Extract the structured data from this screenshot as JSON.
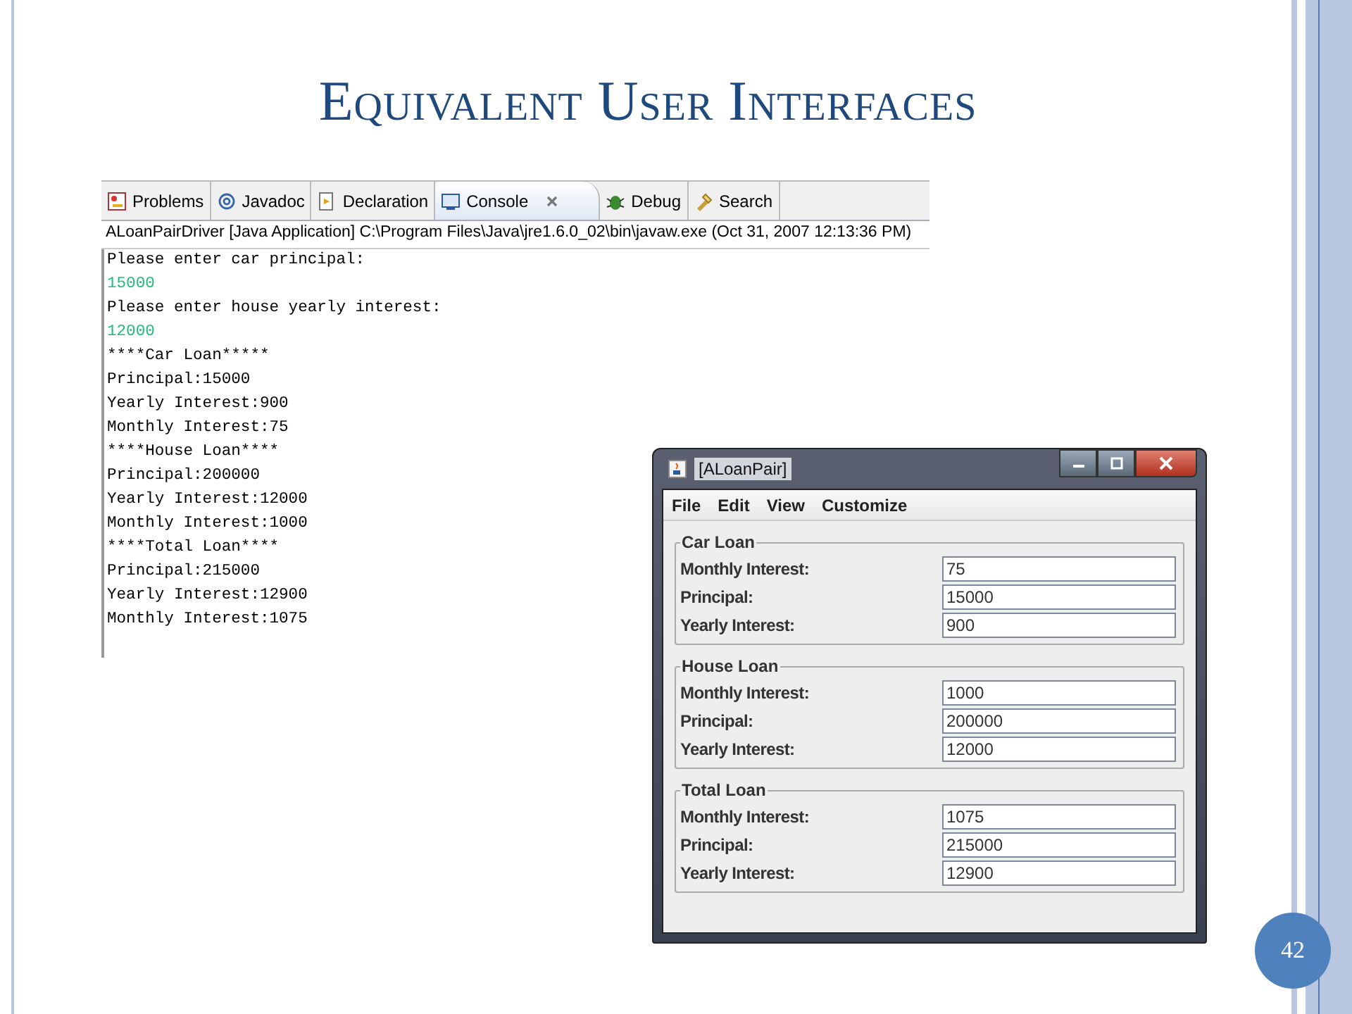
{
  "slide": {
    "title": "Equivalent User Interfaces",
    "page_number": "42"
  },
  "console": {
    "tabs": [
      {
        "label": "Problems",
        "selected": false
      },
      {
        "label": "Javadoc",
        "selected": false
      },
      {
        "label": "Declaration",
        "selected": false
      },
      {
        "label": "Console",
        "selected": true
      },
      {
        "label": "Debug",
        "selected": false
      },
      {
        "label": "Search",
        "selected": false
      }
    ],
    "header": "ALoanPairDriver [Java Application] C:\\Program Files\\Java\\jre1.6.0_02\\bin\\javaw.exe (Oct 31, 2007 12:13:36 PM)",
    "lines": [
      {
        "text": "Please enter car principal:",
        "kind": "output"
      },
      {
        "text": "15000",
        "kind": "input"
      },
      {
        "text": "Please enter house yearly interest:",
        "kind": "output"
      },
      {
        "text": "12000",
        "kind": "input"
      },
      {
        "text": "****Car Loan*****",
        "kind": "output"
      },
      {
        "text": "Principal:15000",
        "kind": "output"
      },
      {
        "text": "Yearly Interest:900",
        "kind": "output"
      },
      {
        "text": "Monthly Interest:75",
        "kind": "output"
      },
      {
        "text": "****House Loan****",
        "kind": "output"
      },
      {
        "text": "Principal:200000",
        "kind": "output"
      },
      {
        "text": "Yearly Interest:12000",
        "kind": "output"
      },
      {
        "text": "Monthly Interest:1000",
        "kind": "output"
      },
      {
        "text": "****Total Loan****",
        "kind": "output"
      },
      {
        "text": "Principal:215000",
        "kind": "output"
      },
      {
        "text": "Yearly Interest:12900",
        "kind": "output"
      },
      {
        "text": "Monthly Interest:1075",
        "kind": "output"
      }
    ]
  },
  "window": {
    "title": "[ALoanPair]",
    "menu": [
      "File",
      "Edit",
      "View",
      "Customize"
    ],
    "groups": [
      {
        "title": "Car Loan",
        "fields": [
          {
            "label": "Monthly Interest:",
            "value": "75"
          },
          {
            "label": "Principal:",
            "value": "15000"
          },
          {
            "label": "Yearly Interest:",
            "value": "900"
          }
        ]
      },
      {
        "title": "House Loan",
        "fields": [
          {
            "label": "Monthly Interest:",
            "value": "1000"
          },
          {
            "label": "Principal:",
            "value": "200000"
          },
          {
            "label": "Yearly Interest:",
            "value": "12000"
          }
        ]
      },
      {
        "title": "Total Loan",
        "fields": [
          {
            "label": "Monthly Interest:",
            "value": "1075"
          },
          {
            "label": "Principal:",
            "value": "215000"
          },
          {
            "label": "Yearly Interest:",
            "value": "12900"
          }
        ]
      }
    ]
  }
}
